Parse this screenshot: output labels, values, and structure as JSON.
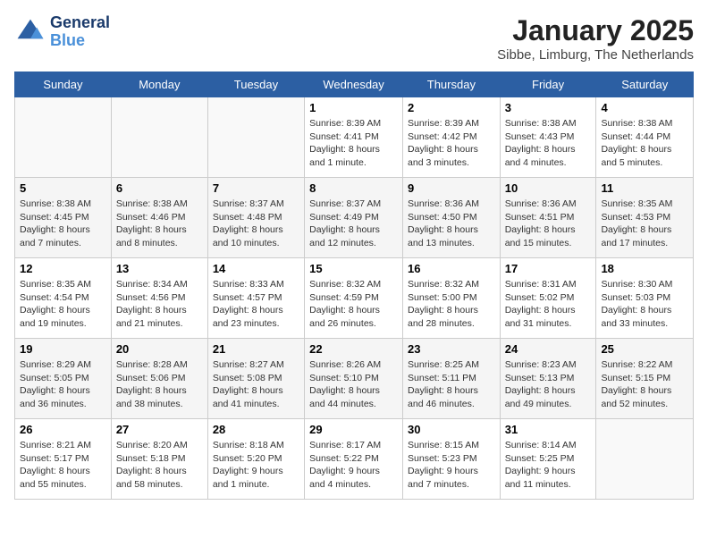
{
  "header": {
    "logo_line1": "General",
    "logo_line2": "Blue",
    "month": "January 2025",
    "location": "Sibbe, Limburg, The Netherlands"
  },
  "weekdays": [
    "Sunday",
    "Monday",
    "Tuesday",
    "Wednesday",
    "Thursday",
    "Friday",
    "Saturday"
  ],
  "weeks": [
    [
      {
        "day": "",
        "info": ""
      },
      {
        "day": "",
        "info": ""
      },
      {
        "day": "",
        "info": ""
      },
      {
        "day": "1",
        "info": "Sunrise: 8:39 AM\nSunset: 4:41 PM\nDaylight: 8 hours\nand 1 minute."
      },
      {
        "day": "2",
        "info": "Sunrise: 8:39 AM\nSunset: 4:42 PM\nDaylight: 8 hours\nand 3 minutes."
      },
      {
        "day": "3",
        "info": "Sunrise: 8:38 AM\nSunset: 4:43 PM\nDaylight: 8 hours\nand 4 minutes."
      },
      {
        "day": "4",
        "info": "Sunrise: 8:38 AM\nSunset: 4:44 PM\nDaylight: 8 hours\nand 5 minutes."
      }
    ],
    [
      {
        "day": "5",
        "info": "Sunrise: 8:38 AM\nSunset: 4:45 PM\nDaylight: 8 hours\nand 7 minutes."
      },
      {
        "day": "6",
        "info": "Sunrise: 8:38 AM\nSunset: 4:46 PM\nDaylight: 8 hours\nand 8 minutes."
      },
      {
        "day": "7",
        "info": "Sunrise: 8:37 AM\nSunset: 4:48 PM\nDaylight: 8 hours\nand 10 minutes."
      },
      {
        "day": "8",
        "info": "Sunrise: 8:37 AM\nSunset: 4:49 PM\nDaylight: 8 hours\nand 12 minutes."
      },
      {
        "day": "9",
        "info": "Sunrise: 8:36 AM\nSunset: 4:50 PM\nDaylight: 8 hours\nand 13 minutes."
      },
      {
        "day": "10",
        "info": "Sunrise: 8:36 AM\nSunset: 4:51 PM\nDaylight: 8 hours\nand 15 minutes."
      },
      {
        "day": "11",
        "info": "Sunrise: 8:35 AM\nSunset: 4:53 PM\nDaylight: 8 hours\nand 17 minutes."
      }
    ],
    [
      {
        "day": "12",
        "info": "Sunrise: 8:35 AM\nSunset: 4:54 PM\nDaylight: 8 hours\nand 19 minutes."
      },
      {
        "day": "13",
        "info": "Sunrise: 8:34 AM\nSunset: 4:56 PM\nDaylight: 8 hours\nand 21 minutes."
      },
      {
        "day": "14",
        "info": "Sunrise: 8:33 AM\nSunset: 4:57 PM\nDaylight: 8 hours\nand 23 minutes."
      },
      {
        "day": "15",
        "info": "Sunrise: 8:32 AM\nSunset: 4:59 PM\nDaylight: 8 hours\nand 26 minutes."
      },
      {
        "day": "16",
        "info": "Sunrise: 8:32 AM\nSunset: 5:00 PM\nDaylight: 8 hours\nand 28 minutes."
      },
      {
        "day": "17",
        "info": "Sunrise: 8:31 AM\nSunset: 5:02 PM\nDaylight: 8 hours\nand 31 minutes."
      },
      {
        "day": "18",
        "info": "Sunrise: 8:30 AM\nSunset: 5:03 PM\nDaylight: 8 hours\nand 33 minutes."
      }
    ],
    [
      {
        "day": "19",
        "info": "Sunrise: 8:29 AM\nSunset: 5:05 PM\nDaylight: 8 hours\nand 36 minutes."
      },
      {
        "day": "20",
        "info": "Sunrise: 8:28 AM\nSunset: 5:06 PM\nDaylight: 8 hours\nand 38 minutes."
      },
      {
        "day": "21",
        "info": "Sunrise: 8:27 AM\nSunset: 5:08 PM\nDaylight: 8 hours\nand 41 minutes."
      },
      {
        "day": "22",
        "info": "Sunrise: 8:26 AM\nSunset: 5:10 PM\nDaylight: 8 hours\nand 44 minutes."
      },
      {
        "day": "23",
        "info": "Sunrise: 8:25 AM\nSunset: 5:11 PM\nDaylight: 8 hours\nand 46 minutes."
      },
      {
        "day": "24",
        "info": "Sunrise: 8:23 AM\nSunset: 5:13 PM\nDaylight: 8 hours\nand 49 minutes."
      },
      {
        "day": "25",
        "info": "Sunrise: 8:22 AM\nSunset: 5:15 PM\nDaylight: 8 hours\nand 52 minutes."
      }
    ],
    [
      {
        "day": "26",
        "info": "Sunrise: 8:21 AM\nSunset: 5:17 PM\nDaylight: 8 hours\nand 55 minutes."
      },
      {
        "day": "27",
        "info": "Sunrise: 8:20 AM\nSunset: 5:18 PM\nDaylight: 8 hours\nand 58 minutes."
      },
      {
        "day": "28",
        "info": "Sunrise: 8:18 AM\nSunset: 5:20 PM\nDaylight: 9 hours\nand 1 minute."
      },
      {
        "day": "29",
        "info": "Sunrise: 8:17 AM\nSunset: 5:22 PM\nDaylight: 9 hours\nand 4 minutes."
      },
      {
        "day": "30",
        "info": "Sunrise: 8:15 AM\nSunset: 5:23 PM\nDaylight: 9 hours\nand 7 minutes."
      },
      {
        "day": "31",
        "info": "Sunrise: 8:14 AM\nSunset: 5:25 PM\nDaylight: 9 hours\nand 11 minutes."
      },
      {
        "day": "",
        "info": ""
      }
    ]
  ]
}
